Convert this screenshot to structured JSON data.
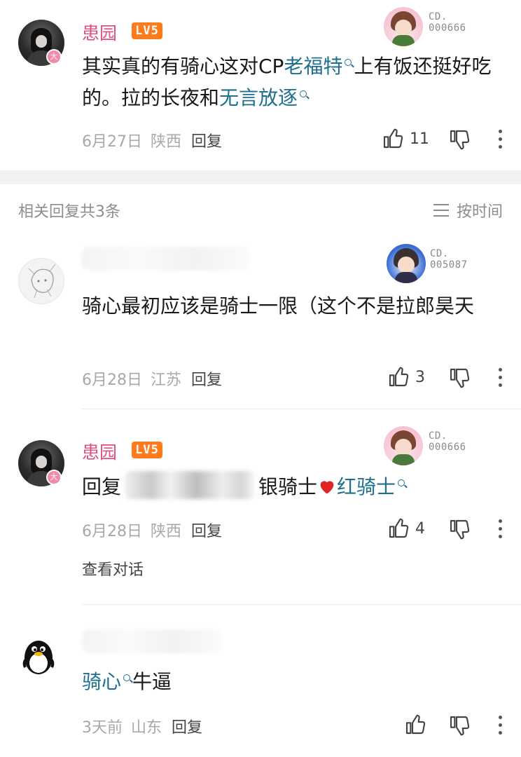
{
  "header_comment": {
    "username": "患园",
    "level": "LV5",
    "fan_badge": {
      "line1": "CD.",
      "line2": "000666"
    },
    "content": {
      "part1": "其实真的有骑心这对CP",
      "link1": "老福特",
      "part2": "上有饭还挺好吃的。拉的长夜和",
      "link2": "无言放逐"
    },
    "date": "6月27日",
    "location": "陕西",
    "reply_label": "回复",
    "likes": "11"
  },
  "related": {
    "label": "相关回复共3条",
    "sort_label": "按时间"
  },
  "reply1": {
    "fan_badge": {
      "line1": "CD.",
      "line2": "005087"
    },
    "content": "骑心最初应该是骑士一限（这个不是拉郎昊天",
    "date": "6月28日",
    "location": "江苏",
    "reply_label": "回复",
    "likes": "3"
  },
  "reply2": {
    "username": "患园",
    "level": "LV5",
    "fan_badge": {
      "line1": "CD.",
      "line2": "000666"
    },
    "content": {
      "prefix": "回复",
      "middle": "银骑士",
      "link": "红骑士"
    },
    "date": "6月28日",
    "location": "陕西",
    "reply_label": "回复",
    "likes": "4",
    "view_conversation": "查看对话"
  },
  "reply3": {
    "content": {
      "link": "骑心",
      "suffix": "牛逼"
    },
    "date": "3天前",
    "location": "山东",
    "reply_label": "回复"
  },
  "colors": {
    "username": "#e0507c",
    "link": "#1f6f8f",
    "level_badge": "#ff7a1a"
  }
}
